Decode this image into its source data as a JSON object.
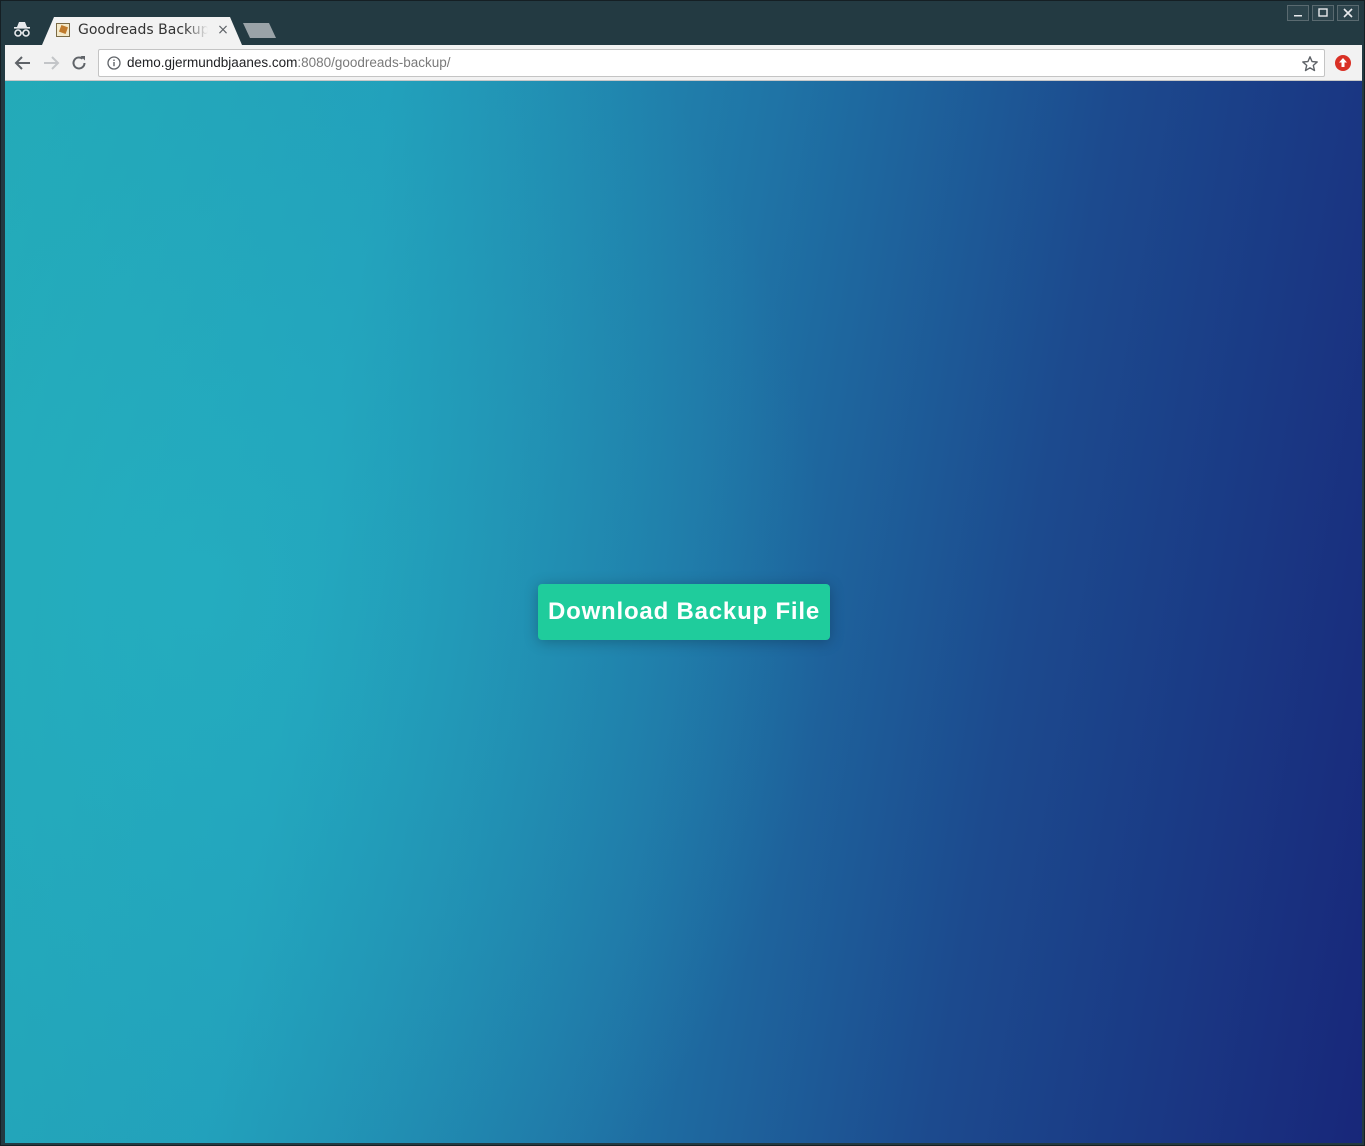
{
  "browser": {
    "tab": {
      "title": "Goodreads Backup",
      "close_glyph": "×",
      "favicon": "goodreads-backup-favicon"
    },
    "address": {
      "host": "demo.gjermundbjaanes.com",
      "port_path": ":8080/goodreads-backup/"
    },
    "window_controls": {
      "minimize": "minimize-icon",
      "maximize": "maximize-icon",
      "close": "close-icon"
    }
  },
  "page": {
    "download_button_label": "Download Backup File",
    "colors": {
      "button_bg": "#1fcc9c",
      "gradient_start": "#23a8b6",
      "gradient_end": "#18277a",
      "chrome_frame": "#233a42"
    }
  }
}
